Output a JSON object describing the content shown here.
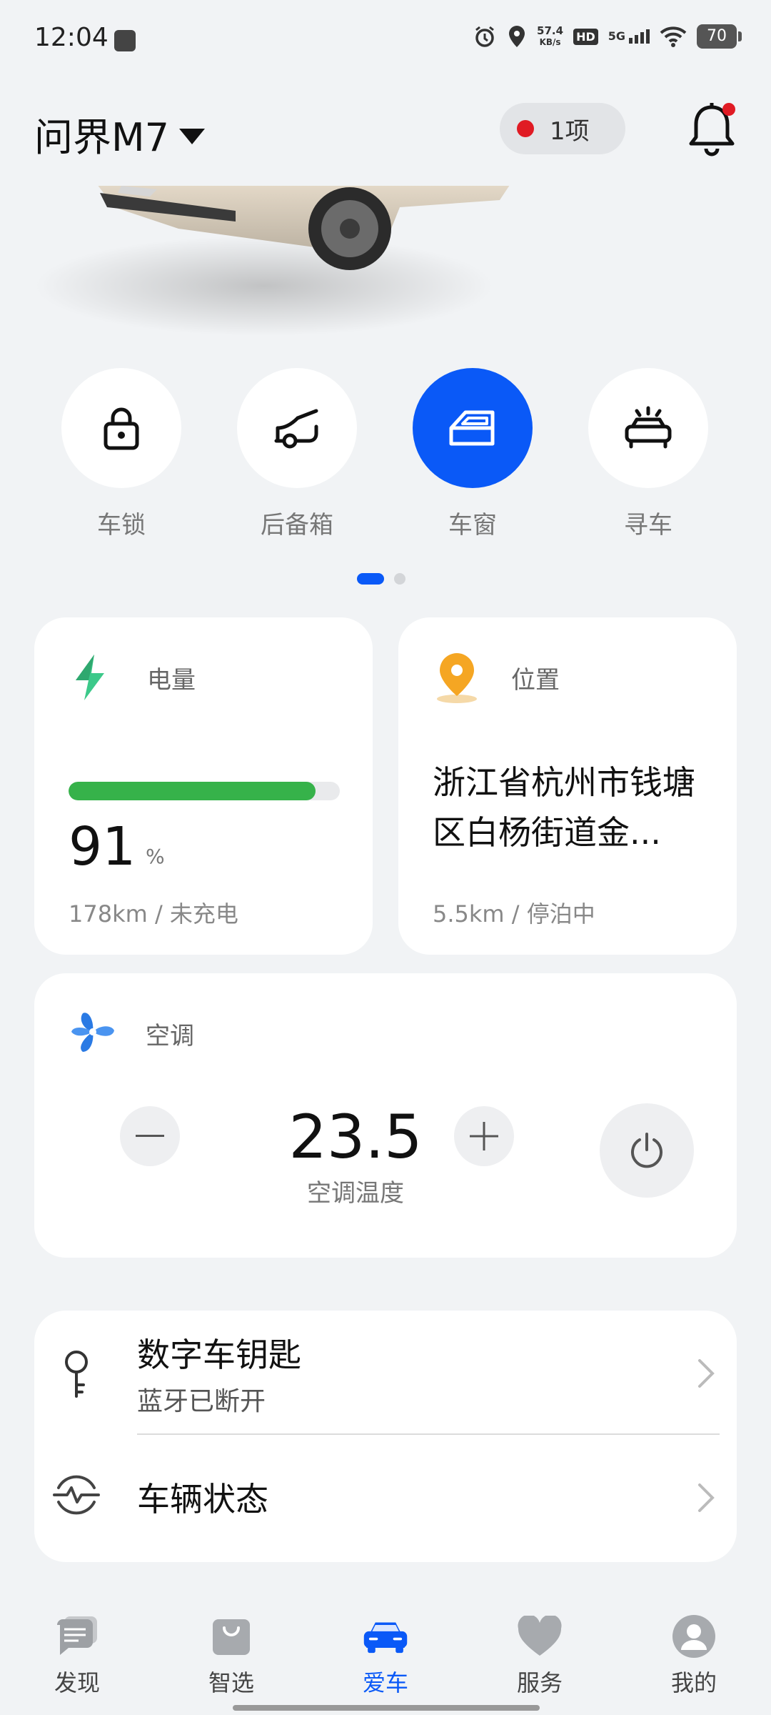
{
  "status_bar": {
    "time": "12:04",
    "net_speed_value": "57.4",
    "net_speed_unit": "KB/s",
    "hd": "HD",
    "network": "5G",
    "battery": "70"
  },
  "header": {
    "car_name": "问界M7",
    "alert_count": "1项"
  },
  "controls": [
    {
      "label": "车锁",
      "icon": "lock-icon",
      "active": false
    },
    {
      "label": "后备箱",
      "icon": "trunk-icon",
      "active": false
    },
    {
      "label": "车窗",
      "icon": "window-icon",
      "active": true
    },
    {
      "label": "寻车",
      "icon": "find-car-icon",
      "active": false
    }
  ],
  "pager": {
    "current": 1,
    "total": 2
  },
  "energy": {
    "title": "电量",
    "percent": "91",
    "percent_unit": "%",
    "level": 0.91,
    "detail": "178km / 未充电",
    "fill_color": "#36b24a"
  },
  "location": {
    "title": "位置",
    "address": "浙江省杭州市钱塘区白杨街道金...",
    "detail": "5.5km / 停泊中"
  },
  "ac": {
    "title": "空调",
    "temperature": "23.5",
    "label": "空调温度"
  },
  "list": {
    "digital_key_title": "数字车钥匙",
    "digital_key_status": "蓝牙已断开",
    "vehicle_status_title": "车辆状态"
  },
  "nav": [
    {
      "label": "发现",
      "icon": "discover-icon",
      "active": false
    },
    {
      "label": "智选",
      "icon": "shopping-bag-icon",
      "active": false
    },
    {
      "label": "爱车",
      "icon": "car-icon",
      "active": true
    },
    {
      "label": "服务",
      "icon": "heart-icon",
      "active": false
    },
    {
      "label": "我的",
      "icon": "profile-icon",
      "active": false
    }
  ],
  "colors": {
    "accent": "#0a59f7",
    "alert": "#e01b24",
    "energy": "#36b24a",
    "location_pin": "#f5a623"
  }
}
